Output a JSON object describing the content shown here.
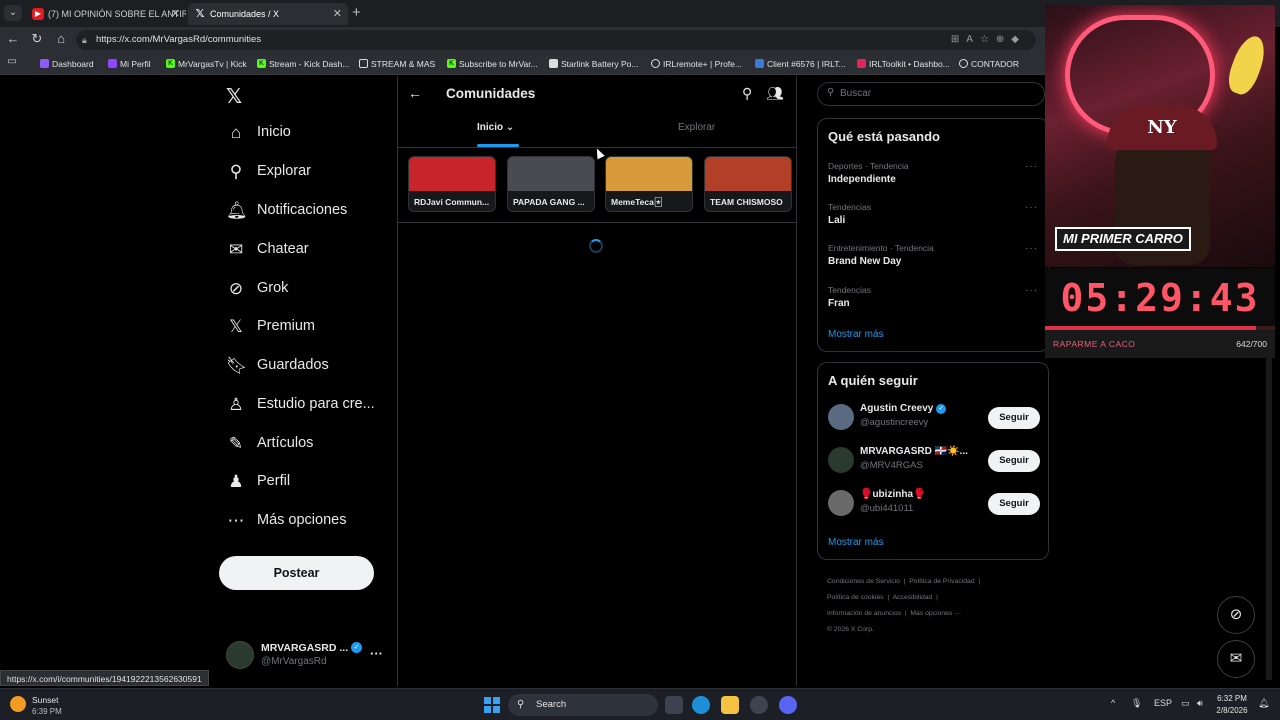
{
  "browser": {
    "tabs": [
      {
        "title": "(7) MI OPINIÓN SOBRE EL ANTIRO",
        "favicon": "youtube-icon"
      },
      {
        "title": "Comunidades / X",
        "favicon": "x-logo-icon"
      }
    ],
    "url": "https://x.com/MrVargasRd/communities",
    "bookmarks": [
      {
        "label": "Dashboard",
        "icon": "bookmark-icon"
      },
      {
        "label": "Mi Perfil",
        "icon": "twitch-icon"
      },
      {
        "label": "MrVargasTv | Kick",
        "icon": "kick-icon"
      },
      {
        "label": "Stream - Kick Dash...",
        "icon": "kick-icon"
      },
      {
        "label": "STREAM & MAS",
        "icon": "folder-icon"
      },
      {
        "label": "Subscribe to MrVar...",
        "icon": "kick-icon"
      },
      {
        "label": "Starlink Battery Po...",
        "icon": "page-icon"
      },
      {
        "label": "IRLremote+ | Profe...",
        "icon": "globe-icon"
      },
      {
        "label": "Client #6576 | IRLT...",
        "icon": "page-icon"
      },
      {
        "label": "IRLToolkit • Dashbo...",
        "icon": "irltoolkit-icon"
      },
      {
        "label": "CONTADOR",
        "icon": "globe-icon"
      }
    ],
    "status_url": "https://x.com/i/communities/1941922213562630591"
  },
  "nav": {
    "items": [
      {
        "label": "Inicio",
        "icon": "home-icon"
      },
      {
        "label": "Explorar",
        "icon": "search-icon"
      },
      {
        "label": "Notificaciones",
        "icon": "bell-icon"
      },
      {
        "label": "Chatear",
        "icon": "mail-icon"
      },
      {
        "label": "Grok",
        "icon": "grok-icon"
      },
      {
        "label": "Premium",
        "icon": "x-logo-icon"
      },
      {
        "label": "Guardados",
        "icon": "bookmark-icon"
      },
      {
        "label": "Estudio para cre...",
        "icon": "creator-studio-icon"
      },
      {
        "label": "Artículos",
        "icon": "articles-icon"
      },
      {
        "label": "Perfil",
        "icon": "person-icon"
      },
      {
        "label": "Más opciones",
        "icon": "more-circle-icon"
      }
    ],
    "post_label": "Postear",
    "account": {
      "name": "MRVARGASRD ...",
      "handle": "@MrVargasRd"
    }
  },
  "main": {
    "title": "Comunidades",
    "tabs": [
      {
        "label": "Inicio",
        "active": true
      },
      {
        "label": "Explorar",
        "active": false
      }
    ],
    "communities": [
      {
        "name": "RDJavi Commun...",
        "color": "#c8242c"
      },
      {
        "name": "PAPADA GANG ...",
        "color": "#4a4a52"
      },
      {
        "name": "MemeTeca🃏",
        "color": "#d69a3a"
      },
      {
        "name": "TEAM CHISMOSO",
        "color": "#b24028"
      }
    ]
  },
  "right": {
    "search_placeholder": "Buscar",
    "trends_title": "Qué está pasando",
    "trends": [
      {
        "category": "Deportes · Tendencia",
        "name": "Independiente"
      },
      {
        "category": "Tendencias",
        "name": "Lali"
      },
      {
        "category": "Entretenimiento · Tendencia",
        "name": "Brand New Day"
      },
      {
        "category": "Tendencias",
        "name": "Fran"
      }
    ],
    "show_more": "Mostrar más",
    "follow_title": "A quién seguir",
    "follow": [
      {
        "name": "Agustin Creevy",
        "handle": "@agustincreevy",
        "verified": true,
        "button": "Seguir"
      },
      {
        "name": "MRVARGASRD 🇩🇴☀️...",
        "handle": "@MRV4RGAS",
        "verified": false,
        "button": "Seguir"
      },
      {
        "name": "🥊ubizinha🥊",
        "handle": "@ubi441011",
        "verified": false,
        "button": "Seguir"
      }
    ],
    "footer": [
      "Condiciones de Servicio",
      "Política de Privacidad",
      "Política de cookies",
      "Accesibilidad",
      "Información de anuncios",
      "Más opciones ···",
      "© 2026 X Corp."
    ]
  },
  "overlay": {
    "sign_text": "MI PRIMER CARRO",
    "timer": "05:29:43",
    "goal_label": "RAPARME A CACO",
    "goal_value": "642/700",
    "goal_progress": 0.917
  },
  "taskbar": {
    "weather_title": "Sunset",
    "weather_sub": "6:39 PM",
    "search_label": "Search",
    "lang": "ESP",
    "time": "6:32 PM",
    "date": "2/8/2026"
  }
}
